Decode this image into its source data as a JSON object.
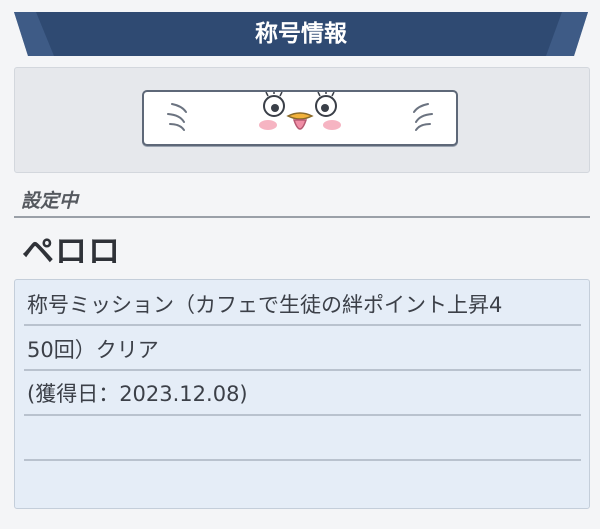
{
  "header": {
    "title": "称号情報",
    "color": "#2f4a72"
  },
  "plate": {
    "image": "pero-bird-face-with-wings"
  },
  "current": {
    "status_label": "設定中",
    "title_name": "ペロロ"
  },
  "description": {
    "lines": [
      "称号ミッション（カフェで生徒の絆ポイント上昇4",
      "50回）クリア",
      "(獲得日：2023.12.08)",
      "",
      ""
    ]
  }
}
